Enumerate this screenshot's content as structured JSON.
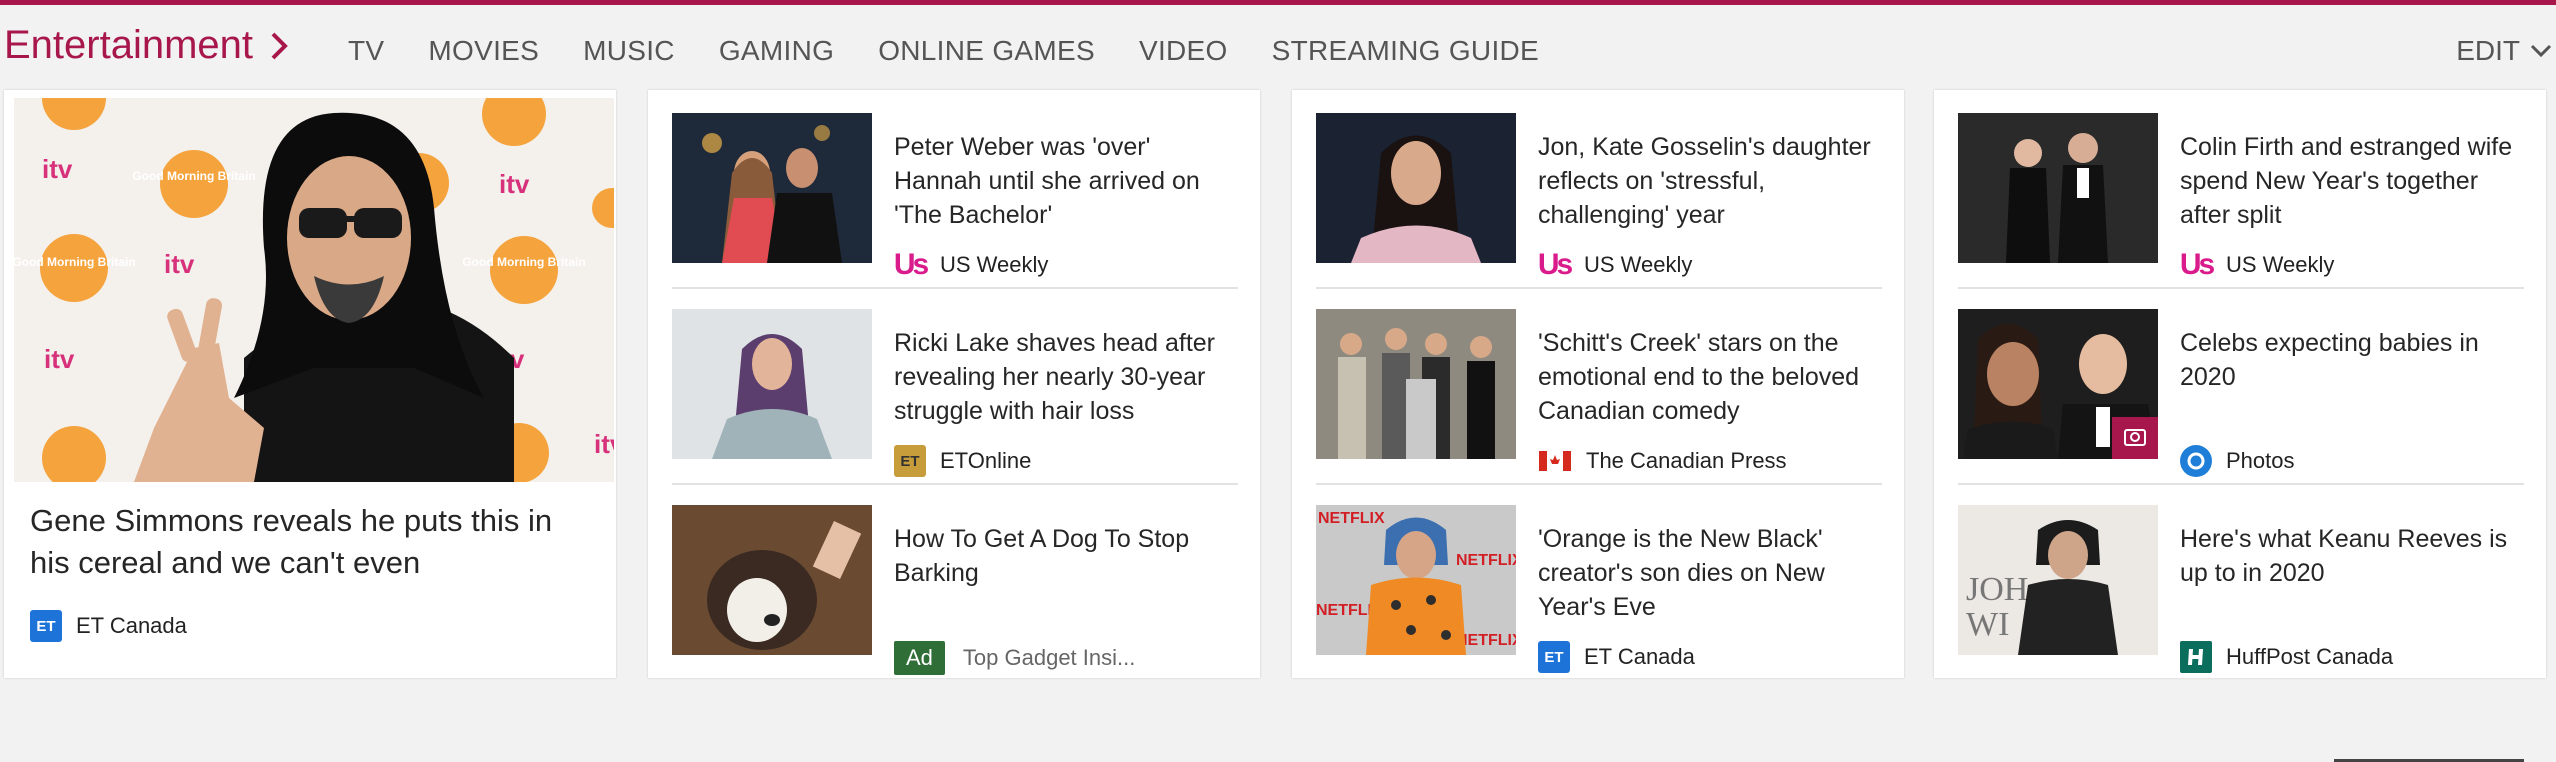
{
  "section": {
    "title": "Entertainment",
    "nav": [
      "TV",
      "MOVIES",
      "MUSIC",
      "GAMING",
      "ONLINE GAMES",
      "VIDEO",
      "STREAMING GUIDE"
    ],
    "edit_label": "EDIT"
  },
  "hero": {
    "title": "Gene Simmons reveals he puts this in his cereal and we can't even",
    "source": "ET Canada",
    "backdrop_text": [
      "Good Morning Britain",
      "itv"
    ]
  },
  "columns": [
    [
      {
        "title": "Peter Weber was 'over' Hannah until she arrived on 'The Bachelor'",
        "source": "US Weekly",
        "logo_text": "Us"
      },
      {
        "title": "Ricki Lake shaves head after revealing her nearly 30-year struggle with hair loss",
        "source": "ETOnline",
        "logo_text": "ET"
      },
      {
        "title": "How To Get A Dog To Stop Barking",
        "source": "Top Gadget Insi...",
        "ad_label": "Ad"
      }
    ],
    [
      {
        "title": "Jon, Kate Gosselin's daughter reflects on 'stressful, challenging' year",
        "source": "US Weekly",
        "logo_text": "Us"
      },
      {
        "title": "'Schitt's Creek' stars on the emotional end to the beloved Canadian comedy",
        "source": "The Canadian Press"
      },
      {
        "title": "'Orange is the New Black' creator's son dies on New Year's Eve",
        "source": "ET Canada",
        "logo_text": "ET"
      }
    ],
    [
      {
        "title": "Colin Firth and estranged wife spend New Year's together after split",
        "source": "US Weekly",
        "logo_text": "Us"
      },
      {
        "title": "Celebs expecting babies in 2020",
        "source": "Photos"
      },
      {
        "title": "Here's what Keanu Reeves is up to in 2020",
        "source": "HuffPost Canada"
      }
    ]
  ],
  "colors": {
    "brand": "#a8174b",
    "ad_badge": "#2f6e36"
  }
}
